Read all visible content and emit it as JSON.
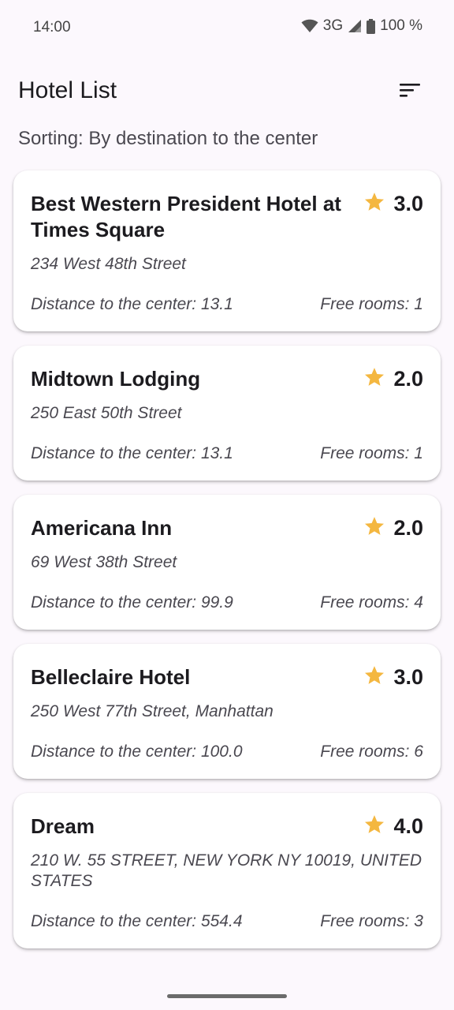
{
  "status_bar": {
    "time": "14:00",
    "network": "3G",
    "battery": "100 %"
  },
  "app_bar": {
    "title": "Hotel List",
    "sort_icon": "sort-icon"
  },
  "sorting_label": "Sorting: By destination to the center",
  "colors": {
    "star": "#F4B740",
    "background": "#FCF8FD",
    "card": "#FFFFFF"
  },
  "hotels": [
    {
      "name": "Best Western President Hotel at Times Square",
      "rating": "3.0",
      "address": "234 West 48th Street",
      "distance": "Distance to the center: 13.1",
      "rooms": "Free rooms: 1"
    },
    {
      "name": "Midtown Lodging",
      "rating": "2.0",
      "address": "250 East 50th Street",
      "distance": "Distance to the center: 13.1",
      "rooms": "Free rooms: 1"
    },
    {
      "name": "Americana Inn",
      "rating": "2.0",
      "address": "69 West 38th Street",
      "distance": "Distance to the center: 99.9",
      "rooms": "Free rooms: 4"
    },
    {
      "name": "Belleclaire Hotel",
      "rating": "3.0",
      "address": "250 West 77th Street, Manhattan",
      "distance": "Distance to the center: 100.0",
      "rooms": "Free rooms: 6"
    },
    {
      "name": "Dream",
      "rating": "4.0",
      "address": "210 W. 55 STREET, NEW YORK NY 10019, UNITED STATES",
      "distance": "Distance to the center: 554.4",
      "rooms": "Free rooms: 3"
    }
  ]
}
